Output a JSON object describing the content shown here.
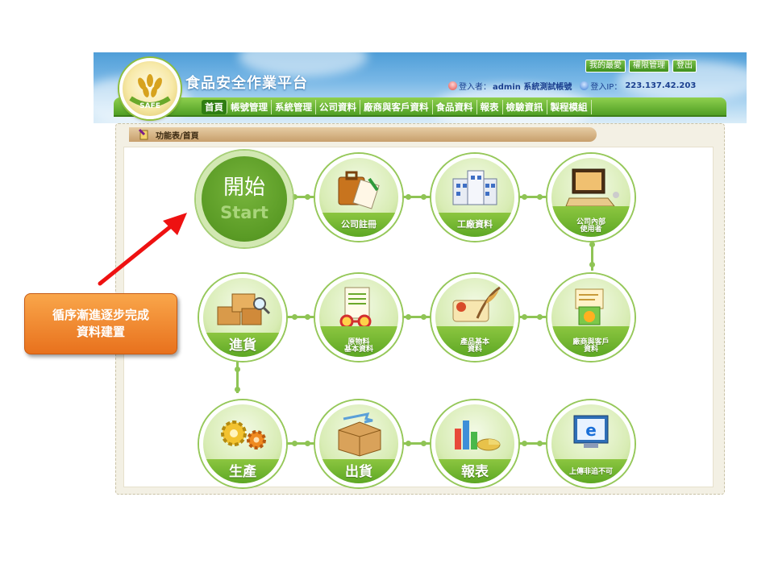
{
  "site": {
    "title": "食品安全作業平台",
    "logo_text": "SAFE"
  },
  "top_links": [
    "我的最愛",
    "權限管理",
    "登出"
  ],
  "user": {
    "login_label": "登入者：",
    "login_value": "admin 系統測試帳號",
    "ip_label": "登入IP：",
    "ip_value": "223.137.42.203"
  },
  "nav": {
    "items": [
      "首頁",
      "帳號管理",
      "系統管理",
      "公司資料",
      "廠商與客戶資料",
      "食品資料",
      "報表",
      "檢驗資訊",
      "製程模組"
    ],
    "active": "首頁"
  },
  "breadcrumb": "功能表/首頁",
  "start": {
    "zh": "開始",
    "en": "Start"
  },
  "nodes": {
    "company_register": "公司註冊",
    "factory_data": "工廠資料",
    "company_users_1": "公司內部",
    "company_users_2": "使用者",
    "purchase": "進貨",
    "raw_material_1": "原物料",
    "raw_material_2": "基本資料",
    "product_basic_1": "產品基本",
    "product_basic_2": "資料",
    "vendor_customer_1": "廠商與客戶",
    "vendor_customer_2": "資料",
    "production": "生產",
    "shipment": "出貨",
    "report": "報表",
    "upload_1": "上傳非追不可"
  },
  "callout": {
    "line1": "循序漸進逐步完成",
    "line2": "資料建置"
  },
  "colors": {
    "accent_green": "#5da724",
    "callout_orange": "#e8711d",
    "arrow_red": "#ee1111"
  }
}
